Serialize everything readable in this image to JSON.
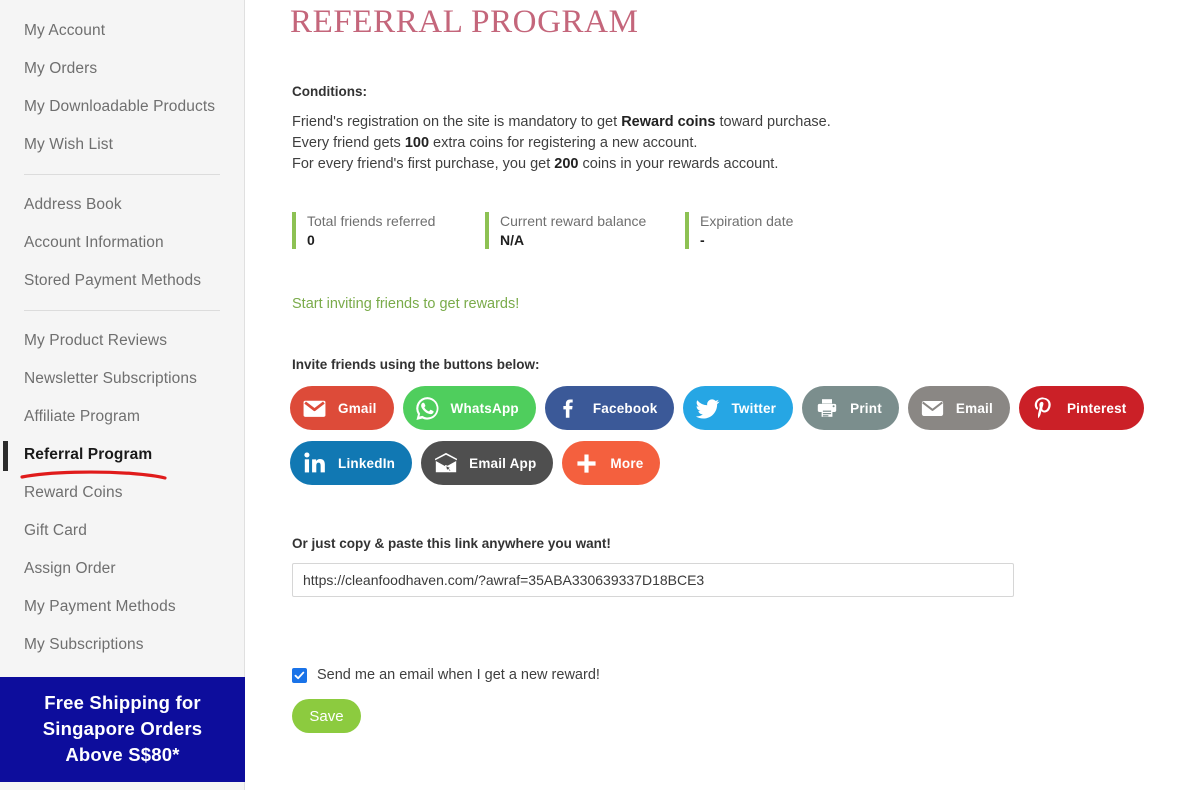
{
  "sidebar": {
    "groups": [
      {
        "items": [
          {
            "label": "My Account",
            "name": "my-account",
            "current": false
          },
          {
            "label": "My Orders",
            "name": "my-orders",
            "current": false
          },
          {
            "label": "My Downloadable Products",
            "name": "my-downloadable-products",
            "current": false
          },
          {
            "label": "My Wish List",
            "name": "my-wish-list",
            "current": false
          }
        ]
      },
      {
        "items": [
          {
            "label": "Address Book",
            "name": "address-book",
            "current": false
          },
          {
            "label": "Account Information",
            "name": "account-information",
            "current": false
          },
          {
            "label": "Stored Payment Methods",
            "name": "stored-payment-methods",
            "current": false
          }
        ]
      },
      {
        "items": [
          {
            "label": "My Product Reviews",
            "name": "my-product-reviews",
            "current": false
          },
          {
            "label": "Newsletter Subscriptions",
            "name": "newsletter-subscriptions",
            "current": false
          },
          {
            "label": "Affiliate Program",
            "name": "affiliate-program",
            "current": false
          },
          {
            "label": "Referral Program",
            "name": "referral-program",
            "current": true
          },
          {
            "label": "Reward Coins",
            "name": "reward-coins",
            "current": false
          },
          {
            "label": "Gift Card",
            "name": "gift-card",
            "current": false
          },
          {
            "label": "Assign Order",
            "name": "assign-order",
            "current": false
          },
          {
            "label": "My Payment Methods",
            "name": "my-payment-methods",
            "current": false
          },
          {
            "label": "My Subscriptions",
            "name": "my-subscriptions",
            "current": false
          }
        ]
      }
    ],
    "promo_banner": {
      "line1": "Free Shipping for",
      "line2": "Singapore Orders",
      "line3": "Above S$80*",
      "background": "#0d0d9c",
      "text_color": "#ffffff"
    },
    "annotation": {
      "type": "red-underline",
      "color": "#e01b1b",
      "target": "Referral Program"
    }
  },
  "main": {
    "title": "REFERRAL PROGRAM",
    "title_color": "#c4667b",
    "conditions": {
      "heading": "Conditions:",
      "line1_a": "Friend's registration on the site is mandatory to get ",
      "line1_b": "Reward coins",
      "line1_c": " toward purchase.",
      "line2_a": "Every friend gets ",
      "line2_b": "100",
      "line2_c": " extra coins for registering a new account.",
      "line3_a": "For every friend's first purchase, you get ",
      "line3_b": "200",
      "line3_c": " coins in your rewards account."
    },
    "stats": [
      {
        "label": "Total friends referred",
        "value": "0",
        "accent": "#8dc153"
      },
      {
        "label": "Current reward balance",
        "value": "N/A",
        "accent": "#8dc153"
      },
      {
        "label": "Expiration date",
        "value": "-",
        "accent": "#8dc153"
      }
    ],
    "start_inviting": "Start inviting friends to get rewards!",
    "start_inviting_color": "#7aab4a",
    "invite_label": "Invite friends using the buttons below:",
    "share_buttons": [
      {
        "label": "Gmail",
        "icon": "gmail-icon",
        "color": "#dd4b39",
        "row": 1
      },
      {
        "label": "WhatsApp",
        "icon": "whatsapp-icon",
        "color": "#4fce5d",
        "row": 1
      },
      {
        "label": "Facebook",
        "icon": "facebook-icon",
        "color": "#3b5998",
        "row": 1
      },
      {
        "label": "Twitter",
        "icon": "twitter-icon",
        "color": "#26a6e4",
        "row": 1
      },
      {
        "label": "Print",
        "icon": "printer-icon",
        "color": "#7b8e8d",
        "row": 1
      },
      {
        "label": "Email",
        "icon": "envelope-icon",
        "color": "#8a8784",
        "row": 1
      },
      {
        "label": "Pinterest",
        "icon": "pinterest-icon",
        "color": "#cb2027",
        "row": 1
      },
      {
        "label": "LinkedIn",
        "icon": "linkedin-icon",
        "color": "#1178b3",
        "row": 2
      },
      {
        "label": "Email App",
        "icon": "email-app-icon",
        "color": "#4f4f4f",
        "row": 2
      },
      {
        "label": "More",
        "icon": "plus-icon",
        "color": "#f4603e",
        "row": 2
      }
    ],
    "copy_link": {
      "label": "Or just copy & paste this link anywhere you want!",
      "value": "https://cleanfoodhaven.com/?awraf=35ABA330639337D18BCE3",
      "placeholder": ""
    },
    "notify": {
      "label": "Send me an email when I get a new reward!",
      "checked": true,
      "checkbox_color": "#1a73e8"
    },
    "save_button": {
      "label": "Save",
      "color": "#8ccb3f"
    },
    "scroll_top": {
      "icon": "chevron-up-icon",
      "color": "#8ccb3f"
    }
  }
}
